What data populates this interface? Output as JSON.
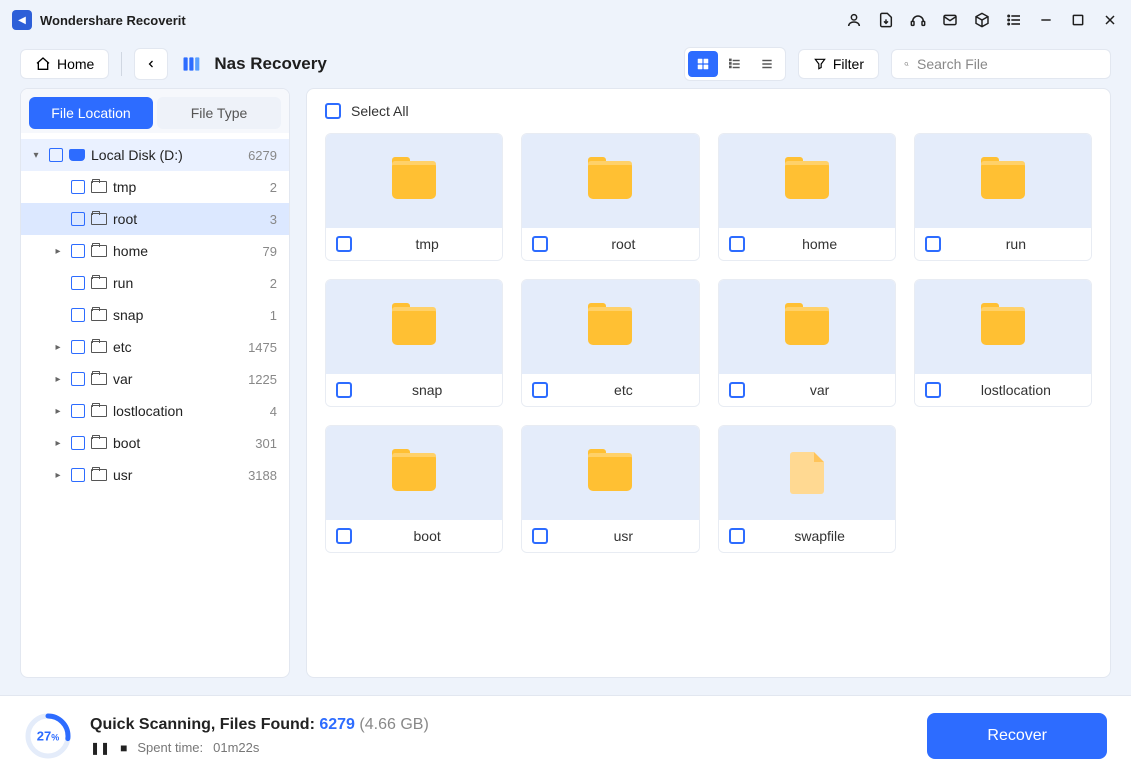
{
  "app": {
    "title": "Wondershare Recoverit"
  },
  "toolbar": {
    "home": "Home",
    "filter": "Filter",
    "breadcrumb": "Nas Recovery",
    "search_placeholder": "Search File"
  },
  "sidebar": {
    "tabs": {
      "file_location": "File Location",
      "file_type": "File Type"
    },
    "root": {
      "label": "Local Disk (D:)",
      "count": "6279"
    },
    "items": [
      {
        "label": "tmp",
        "count": "2",
        "expandable": false
      },
      {
        "label": "root",
        "count": "3",
        "expandable": false,
        "selected": true
      },
      {
        "label": "home",
        "count": "79",
        "expandable": true
      },
      {
        "label": "run",
        "count": "2",
        "expandable": false
      },
      {
        "label": "snap",
        "count": "1",
        "expandable": false
      },
      {
        "label": "etc",
        "count": "1475",
        "expandable": true
      },
      {
        "label": "var",
        "count": "1225",
        "expandable": true
      },
      {
        "label": "lostlocation",
        "count": "4",
        "expandable": true
      },
      {
        "label": "boot",
        "count": "301",
        "expandable": true
      },
      {
        "label": "usr",
        "count": "3188",
        "expandable": true
      }
    ]
  },
  "content": {
    "select_all": "Select All",
    "items": [
      {
        "name": "tmp",
        "type": "folder"
      },
      {
        "name": "root",
        "type": "folder"
      },
      {
        "name": "home",
        "type": "folder"
      },
      {
        "name": "run",
        "type": "folder"
      },
      {
        "name": "snap",
        "type": "folder"
      },
      {
        "name": "etc",
        "type": "folder"
      },
      {
        "name": "var",
        "type": "folder"
      },
      {
        "name": "lostlocation",
        "type": "folder"
      },
      {
        "name": "boot",
        "type": "folder"
      },
      {
        "name": "usr",
        "type": "folder"
      },
      {
        "name": "swapfile",
        "type": "file"
      }
    ]
  },
  "status": {
    "progress_percent": "27",
    "progress_suffix": "%",
    "scanning_label": "Quick Scanning, Files Found:",
    "found_count": "6279",
    "size": "(4.66 GB)",
    "spent_label": "Spent time:",
    "spent_value": "01m22s",
    "recover": "Recover"
  }
}
